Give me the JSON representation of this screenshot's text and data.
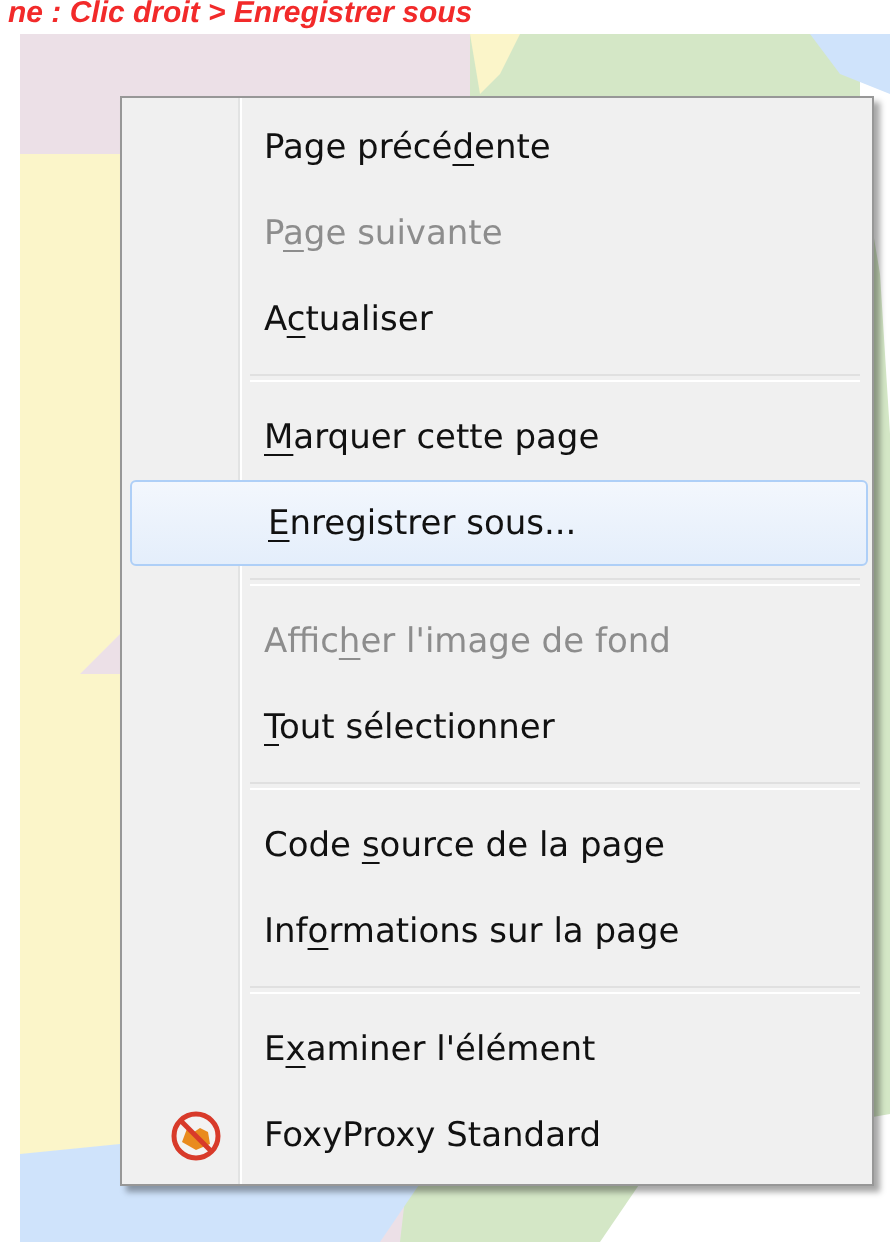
{
  "caption": "ne : Clic droit > Enregistrer sous",
  "context_menu": {
    "items": [
      {
        "kind": "item",
        "label": [
          {
            "text": "Page précé",
            "underlined": false
          },
          {
            "text": "d",
            "underlined": true
          },
          {
            "text": "ente",
            "underlined": false
          }
        ],
        "disabled": false,
        "selected": false
      },
      {
        "kind": "item",
        "label": [
          {
            "text": "P",
            "underlined": false
          },
          {
            "text": "a",
            "underlined": true
          },
          {
            "text": "ge suivante",
            "underlined": false
          }
        ],
        "disabled": true,
        "selected": false
      },
      {
        "kind": "item",
        "label": [
          {
            "text": "A",
            "underlined": false
          },
          {
            "text": "c",
            "underlined": true
          },
          {
            "text": "tualiser",
            "underlined": false
          }
        ],
        "disabled": false,
        "selected": false
      },
      {
        "kind": "separator"
      },
      {
        "kind": "item",
        "label": [
          {
            "text": "M",
            "underlined": true
          },
          {
            "text": "arquer cette page",
            "underlined": false
          }
        ],
        "disabled": false,
        "selected": false
      },
      {
        "kind": "item",
        "label": [
          {
            "text": "E",
            "underlined": true
          },
          {
            "text": "nregistrer sous...",
            "underlined": false
          }
        ],
        "disabled": false,
        "selected": true
      },
      {
        "kind": "separator"
      },
      {
        "kind": "item",
        "label": [
          {
            "text": "Affic",
            "underlined": false
          },
          {
            "text": "h",
            "underlined": true
          },
          {
            "text": "er l'image de fond",
            "underlined": false
          }
        ],
        "disabled": true,
        "selected": false
      },
      {
        "kind": "item",
        "label": [
          {
            "text": "T",
            "underlined": true
          },
          {
            "text": "out sélectionner",
            "underlined": false
          }
        ],
        "disabled": false,
        "selected": false
      },
      {
        "kind": "separator"
      },
      {
        "kind": "item",
        "label": [
          {
            "text": "Code ",
            "underlined": false
          },
          {
            "text": "s",
            "underlined": true
          },
          {
            "text": "ource de la page",
            "underlined": false
          }
        ],
        "disabled": false,
        "selected": false
      },
      {
        "kind": "item",
        "label": [
          {
            "text": "Inf",
            "underlined": false
          },
          {
            "text": "o",
            "underlined": true
          },
          {
            "text": "rmations sur la page",
            "underlined": false
          }
        ],
        "disabled": false,
        "selected": false
      },
      {
        "kind": "separator"
      },
      {
        "kind": "item",
        "label": [
          {
            "text": "E",
            "underlined": false
          },
          {
            "text": "x",
            "underlined": true
          },
          {
            "text": "aminer l'élément",
            "underlined": false
          }
        ],
        "disabled": false,
        "selected": false
      },
      {
        "kind": "extension",
        "label": [
          {
            "text": "FoxyProxy Standard",
            "underlined": false
          }
        ],
        "disabled": false,
        "selected": false
      }
    ]
  }
}
